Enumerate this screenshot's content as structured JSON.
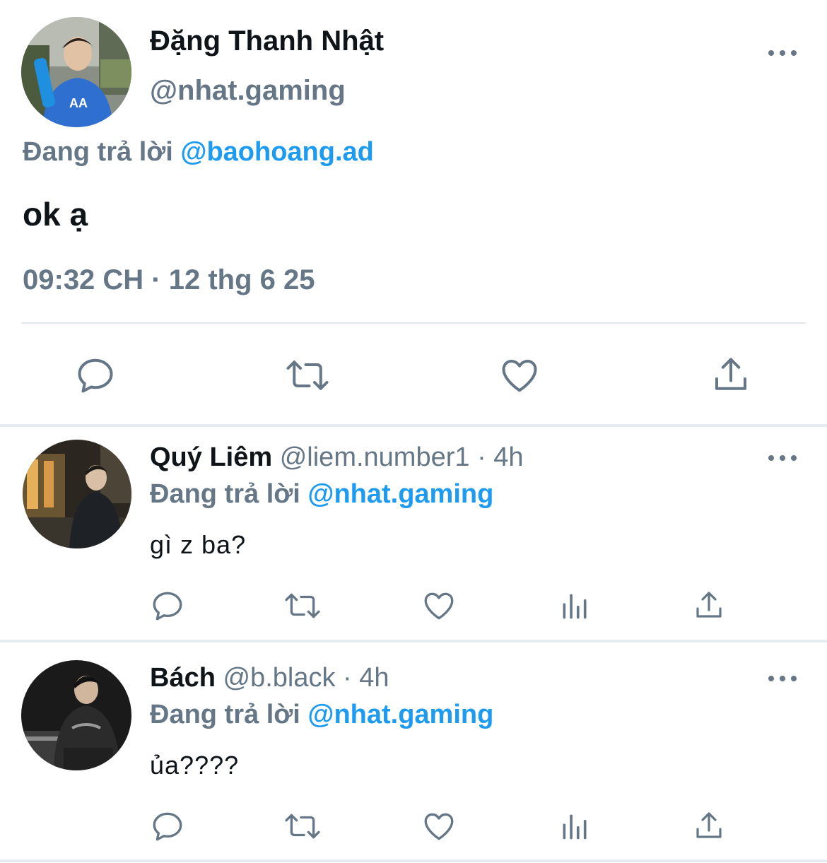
{
  "main_tweet": {
    "display_name": "Đặng Thanh Nhật",
    "handle": "@nhat.gaming",
    "reply_prefix": "Đang trả lời",
    "reply_to": "@baohoang.ad",
    "text": "ok ạ",
    "timestamp": "09:32 CH · 12 thg 6 25",
    "actions": [
      "reply-icon",
      "retweet-icon",
      "like-icon",
      "share-icon"
    ]
  },
  "replies": [
    {
      "display_name": "Quý Liêm",
      "handle": "@liem.number1",
      "separator": "·",
      "time": "4h",
      "reply_prefix": "Đang trả lời",
      "reply_to": "@nhat.gaming",
      "text": "gì z ba?",
      "actions": [
        "reply-icon",
        "retweet-icon",
        "like-icon",
        "analytics-icon",
        "share-icon"
      ]
    },
    {
      "display_name": "Bách",
      "handle": "@b.black",
      "separator": "·",
      "time": "4h",
      "reply_prefix": "Đang trả lời",
      "reply_to": "@nhat.gaming",
      "text": "ủa????",
      "actions": [
        "reply-icon",
        "retweet-icon",
        "like-icon",
        "analytics-icon",
        "share-icon"
      ]
    }
  ],
  "colors": {
    "text_primary": "#0f1419",
    "text_secondary": "#657786",
    "mention": "#1d9bf0",
    "divider": "#e1e8ed"
  }
}
